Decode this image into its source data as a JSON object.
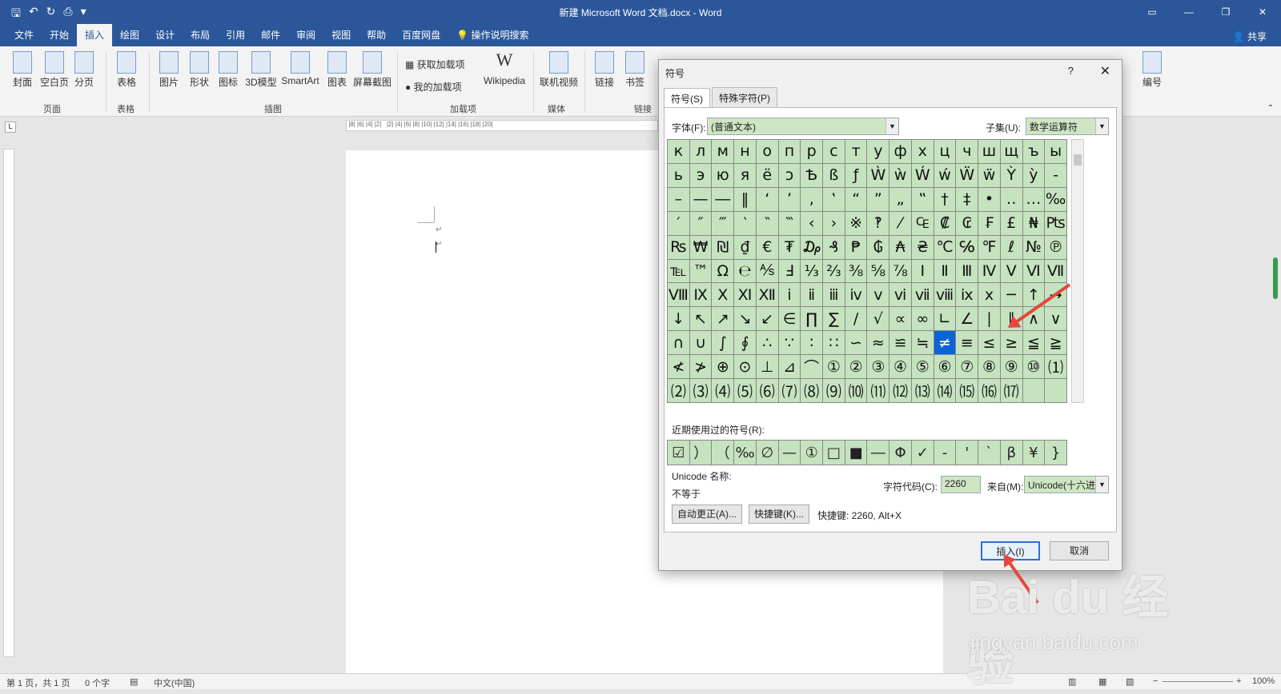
{
  "window": {
    "title": "新建 Microsoft Word 文档.docx  -  Word"
  },
  "tabs": [
    "文件",
    "开始",
    "插入",
    "绘图",
    "设计",
    "布局",
    "引用",
    "邮件",
    "审阅",
    "视图",
    "帮助",
    "百度网盘",
    "操作说明搜索"
  ],
  "active_tab": "插入",
  "share": "共享",
  "ribbon": {
    "buttons": [
      "封面",
      "空白页",
      "分页",
      "表格",
      "图片",
      "形状",
      "图标",
      "3D模型",
      "SmartArt",
      "图表",
      "屏幕截图",
      "获取加载项",
      "我的加载项",
      "Wikipedia",
      "联机视频",
      "链接",
      "书签",
      "编号"
    ],
    "groups": [
      "页面",
      "表格",
      "插图",
      "加载项",
      "媒体",
      "链接"
    ]
  },
  "status": {
    "page": "第 1 页，共 1 页",
    "words": "0 个字",
    "lang": "中文(中国)",
    "zoom": "100%"
  },
  "dialog": {
    "title": "符号",
    "help": "?",
    "close": "✕",
    "tab_symbols": "符号(S)",
    "tab_special": "特殊字符(P)",
    "font_label": "字体(F):",
    "font_value": "(普通文本)",
    "subset_label": "子集(U):",
    "subset_value": "数学运算符",
    "symbols": [
      "к",
      "л",
      "м",
      "н",
      "о",
      "п",
      "р",
      "с",
      "т",
      "у",
      "ф",
      "х",
      "ц",
      "ч",
      "ш",
      "щ",
      "ъ",
      "ы",
      "ь",
      "э",
      "ю",
      "я",
      "ё",
      "ↄ",
      "Ѣ",
      "ß",
      "ƒ",
      "Ẁ",
      "ẁ",
      "Ẃ",
      "ẃ",
      "Ẅ",
      "ẅ",
      "Ỳ",
      "ỳ",
      "‐",
      "–",
      "—",
      "―",
      "‖",
      "‘",
      "’",
      "‚",
      "‛",
      "“",
      "”",
      "„",
      "‟",
      "†",
      "‡",
      "•",
      "‥",
      "…",
      "‰",
      "′",
      "″",
      "‴",
      "‵",
      "‶",
      "‷",
      "‹",
      "›",
      "※",
      "‽",
      "⁄",
      "₠",
      "₡",
      "₢",
      "₣",
      "£",
      "₦",
      "₧",
      "₨",
      "₩",
      "₪",
      "₫",
      "€",
      "₮",
      "₯",
      "₰",
      "₱",
      "₲",
      "₳",
      "₴",
      "℃",
      "℅",
      "℉",
      "ℓ",
      "№",
      "℗",
      "℡",
      "™",
      "Ω",
      "℮",
      "⅍",
      "Ⅎ",
      "⅓",
      "⅔",
      "⅜",
      "⅝",
      "⅞",
      "Ⅰ",
      "Ⅱ",
      "Ⅲ",
      "Ⅳ",
      "Ⅴ",
      "Ⅵ",
      "Ⅶ",
      "Ⅷ",
      "Ⅸ",
      "Ⅹ",
      "Ⅺ",
      "Ⅻ",
      "ⅰ",
      "ⅱ",
      "ⅲ",
      "ⅳ",
      "ⅴ",
      "ⅵ",
      "ⅶ",
      "ⅷ",
      "ⅸ",
      "ⅹ",
      "─",
      "↑",
      "→",
      "↓",
      "↖",
      "↗",
      "↘",
      "↙",
      "∈",
      "∏",
      "∑",
      "∕",
      "√",
      "∝",
      "∞",
      "∟",
      "∠",
      "∣",
      "∥",
      "∧",
      "∨",
      "∩",
      "∪",
      "∫",
      "∮",
      "∴",
      "∵",
      "∶",
      "∷",
      "∽",
      "≈",
      "≌",
      "≒",
      "≠",
      "≡",
      "≤",
      "≥",
      "≦",
      "≧",
      "≮",
      "≯",
      "⊕",
      "⊙",
      "⊥",
      "⊿",
      "⌒",
      "①",
      "②",
      "③",
      "④",
      "⑤",
      "⑥",
      "⑦",
      "⑧",
      "⑨",
      "⑩",
      "⑴",
      "⑵",
      "⑶",
      "⑷",
      "⑸",
      "⑹",
      "⑺",
      "⑻",
      "⑼",
      "⑽",
      "⑾",
      "⑿",
      "⒀",
      "⒁",
      "⒂",
      "⒃",
      "⒄",
      "",
      ""
    ],
    "selected_symbol": "≠",
    "recent_label": "近期使用过的符号(R):",
    "recent": [
      "☑",
      "）",
      "（",
      "‰",
      "∅",
      "—",
      "①",
      "□",
      "■",
      "―",
      "Φ",
      "✓",
      "-",
      "'",
      "`",
      "β",
      "¥",
      "}"
    ],
    "unicode_name_label": "Unicode 名称:",
    "unicode_name": "不等于",
    "char_code_label": "字符代码(C):",
    "char_code": "2260",
    "from_label": "来自(M):",
    "from_value": "Unicode(十六进制)",
    "autocorrect": "自动更正(A)...",
    "shortcut_btn": "快捷键(K)...",
    "shortcut_text": "快捷键: 2260, Alt+X",
    "insert": "插入(I)",
    "cancel": "取消"
  },
  "watermark": {
    "brand": "Bai du 经验",
    "url": "jingyan.baidu.com"
  }
}
